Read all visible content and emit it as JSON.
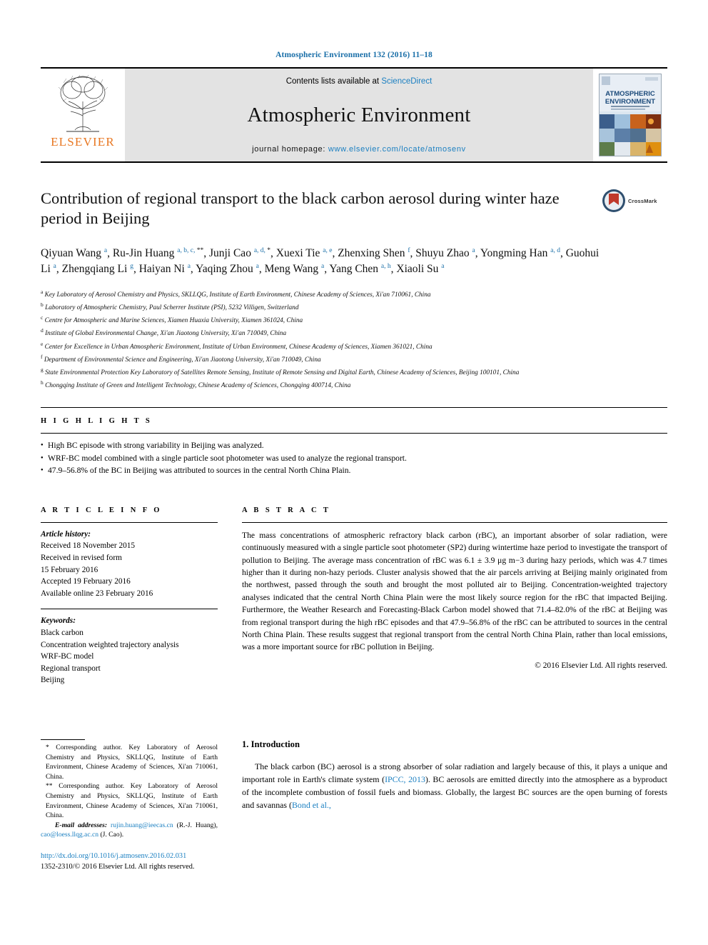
{
  "journal_ref": "Atmospheric Environment 132 (2016) 11–18",
  "masthead": {
    "publisher": "ELSEVIER",
    "contents_prefix": "Contents lists available at ",
    "contents_link": "ScienceDirect",
    "journal_title": "Atmospheric Environment",
    "homepage_prefix": "journal homepage: ",
    "homepage_url": "www.elsevier.com/locate/atmosenv",
    "cover_title_line1": "ATMOSPHERIC",
    "cover_title_line2": "ENVIRONMENT"
  },
  "article": {
    "title": "Contribution of regional transport to the black carbon aerosol during winter haze period in Beijing",
    "crossmark_label": "CrossMark"
  },
  "authors_html": "Qiyuan Wang <sup>a</sup>, Ru-Jin Huang <sup>a, b, c, </sup><sup class=\"star\">**</sup>, Junji Cao <sup>a, d, </sup><sup class=\"star\">*</sup>, Xuexi Tie <sup>a, e</sup>, Zhenxing Shen <sup>f</sup>, Shuyu Zhao <sup>a</sup>, Yongming Han <sup>a, d</sup>, Guohui Li <sup>a</sup>, Zhengqiang Li <sup>g</sup>, Haiyan Ni <sup>a</sup>, Yaqing Zhou <sup>a</sup>, Meng Wang <sup>a</sup>, Yang Chen <sup>a, h</sup>, Xiaoli Su <sup>a</sup>",
  "affiliations": [
    {
      "marker": "a",
      "text": "Key Laboratory of Aerosol Chemistry and Physics, SKLLQG, Institute of Earth Environment, Chinese Academy of Sciences, Xi'an 710061, China"
    },
    {
      "marker": "b",
      "text": "Laboratory of Atmospheric Chemistry, Paul Scherrer Institute (PSI), 5232 Villigen, Switzerland"
    },
    {
      "marker": "c",
      "text": "Centre for Atmospheric and Marine Sciences, Xiamen Huaxia University, Xiamen 361024, China"
    },
    {
      "marker": "d",
      "text": "Institute of Global Environmental Change, Xi'an Jiaotong University, Xi'an 710049, China"
    },
    {
      "marker": "e",
      "text": "Center for Excellence in Urban Atmospheric Environment, Institute of Urban Environment, Chinese Academy of Sciences, Xiamen 361021, China"
    },
    {
      "marker": "f",
      "text": "Department of Environmental Science and Engineering, Xi'an Jiaotong University, Xi'an 710049, China"
    },
    {
      "marker": "g",
      "text": "State Environmental Protection Key Laboratory of Satellites Remote Sensing, Institute of Remote Sensing and Digital Earth, Chinese Academy of Sciences, Beijing 100101, China"
    },
    {
      "marker": "h",
      "text": "Chongqing Institute of Green and Intelligent Technology, Chinese Academy of Sciences, Chongqing 400714, China"
    }
  ],
  "highlights": {
    "heading": "H I G H L I G H T S",
    "items": [
      "High BC episode with strong variability in Beijing was analyzed.",
      "WRF-BC model combined with a single particle soot photometer was used to analyze the regional transport.",
      "47.9–56.8% of the BC in Beijing was attributed to sources in the central North China Plain."
    ]
  },
  "article_info": {
    "heading": "A R T I C L E   I N F O",
    "history_label": "Article history:",
    "history_lines": [
      "Received 18 November 2015",
      "Received in revised form",
      "15 February 2016",
      "Accepted 19 February 2016",
      "Available online 23 February 2016"
    ],
    "keywords_label": "Keywords:",
    "keywords": [
      "Black carbon",
      "Concentration weighted trajectory analysis",
      "WRF-BC model",
      "Regional transport",
      "Beijing"
    ]
  },
  "abstract": {
    "heading": "A B S T R A C T",
    "text": "The mass concentrations of atmospheric refractory black carbon (rBC), an important absorber of solar radiation, were continuously measured with a single particle soot photometer (SP2) during wintertime haze period to investigate the transport of pollution to Beijing. The average mass concentration of rBC was 6.1 ± 3.9 μg m−3 during hazy periods, which was 4.7 times higher than it during non-hazy periods. Cluster analysis showed that the air parcels arriving at Beijing mainly originated from the northwest, passed through the south and brought the most polluted air to Beijing. Concentration-weighted trajectory analyses indicated that the central North China Plain were the most likely source region for the rBC that impacted Beijing. Furthermore, the Weather Research and Forecasting-Black Carbon model showed that 71.4–82.0% of the rBC at Beijing was from regional transport during the high rBC episodes and that 47.9–56.8% of the rBC can be attributed to sources in the central North China Plain. These results suggest that regional transport from the central North China Plain, rather than local emissions, was a more important source for rBC pollution in Beijing.",
    "copyright": "© 2016 Elsevier Ltd. All rights reserved."
  },
  "footnotes": {
    "corresponding_1": "* Corresponding author. Key Laboratory of Aerosol Chemistry and Physics, SKLLQG, Institute of Earth Environment, Chinese Academy of Sciences, Xi'an 710061, China.",
    "corresponding_2": "** Corresponding author. Key Laboratory of Aerosol Chemistry and Physics, SKLLQG, Institute of Earth Environment, Chinese Academy of Sciences, Xi'an 710061, China.",
    "email_label": "E-mail addresses:",
    "email_1": "rujin.huang@ieecas.cn",
    "email_1_owner": "(R.-J. Huang),",
    "email_2": "cao@loess.llqg.ac.cn",
    "email_2_owner": "(J. Cao)."
  },
  "doi": {
    "url": "http://dx.doi.org/10.1016/j.atmosenv.2016.02.031",
    "issn_line": "1352-2310/© 2016 Elsevier Ltd. All rights reserved."
  },
  "introduction": {
    "heading": "1. Introduction",
    "paragraph_1_part1": "The black carbon (BC) aerosol is a strong absorber of solar radiation and largely because of this, it plays a unique and important role in Earth's climate system (",
    "citation_1": "IPCC, 2013",
    "paragraph_1_part2": "). BC aerosols are emitted directly into the atmosphere as a byproduct of the incomplete combustion of fossil fuels and biomass. Globally, the largest BC sources are the open burning of forests and savannas (",
    "citation_2": "Bond et al.,"
  },
  "colors": {
    "link_blue": "#1a7fc1",
    "journal_blue": "#1a6fa8",
    "elsevier_orange": "#E87722",
    "masthead_gray": "#e3e3e3"
  }
}
